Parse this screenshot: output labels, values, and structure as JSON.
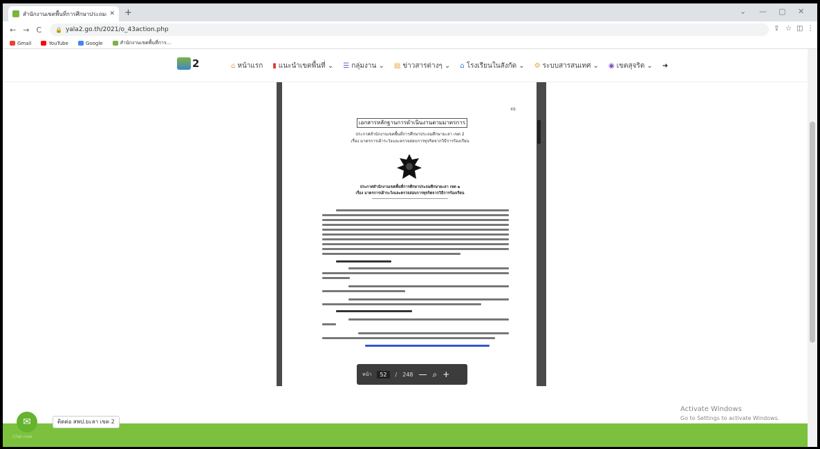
{
  "browser": {
    "tab_title": "สำนักงานเขตพื้นที่การศึกษาประถมศึก",
    "url": "yala2.go.th/2021/o_43action.php",
    "bookmarks": [
      "Gmail",
      "YouTube",
      "Google",
      "สำนักงานเขตพื้นที่การ..."
    ]
  },
  "site": {
    "logo_text": "2",
    "menu": [
      {
        "icon": "home-icon",
        "label": "หน้าแรก"
      },
      {
        "icon": "building-icon",
        "label": "แนะนำเขตพื้นที่ ⌄"
      },
      {
        "icon": "list-icon",
        "label": "กลุ่มงาน ⌄"
      },
      {
        "icon": "news-icon",
        "label": "ข่าวสารต่างๆ ⌄"
      },
      {
        "icon": "school-icon",
        "label": "โรงเรียนในสังกัด ⌄"
      },
      {
        "icon": "system-icon",
        "label": "ระบบสารสนเทศ ⌄"
      },
      {
        "icon": "globe-icon",
        "label": "เขตสุจริต ⌄"
      }
    ]
  },
  "pdf": {
    "page_number_label": "49",
    "title": "เอกสารหลักฐานการดำเนินงานตามมาตรการ",
    "subtitle1": "ประกาศสำนักงานเขตพื้นที่การศึกษาประถมศึกษายะลา เขต 2",
    "subtitle2": "เรื่อง มาตรการเฝ้าระวังและตรวจสอบการทุจริตจากวิธีการร้องเรียน",
    "caption1": "ประกาศสำนักงานเขตพื้นที่การศึกษาประถมศึกษายะลา เขต ๒",
    "caption2": "เรื่อง มาตรการเฝ้าระวังและตรวจสอบการทุจริตจากวิธีการร้องเรียน",
    "toolbar": {
      "page_label": "หน้า",
      "current_page": "52",
      "separator": "/",
      "total_pages": "248",
      "zoom_out": "—",
      "zoom_in": "+"
    }
  },
  "chat": {
    "label": "ติดต่อ สพป.ยะลา เขต 2",
    "sub": "Chat now"
  },
  "windows_watermark": {
    "line1": "Activate Windows",
    "line2": "Go to Settings to activate Windows."
  }
}
